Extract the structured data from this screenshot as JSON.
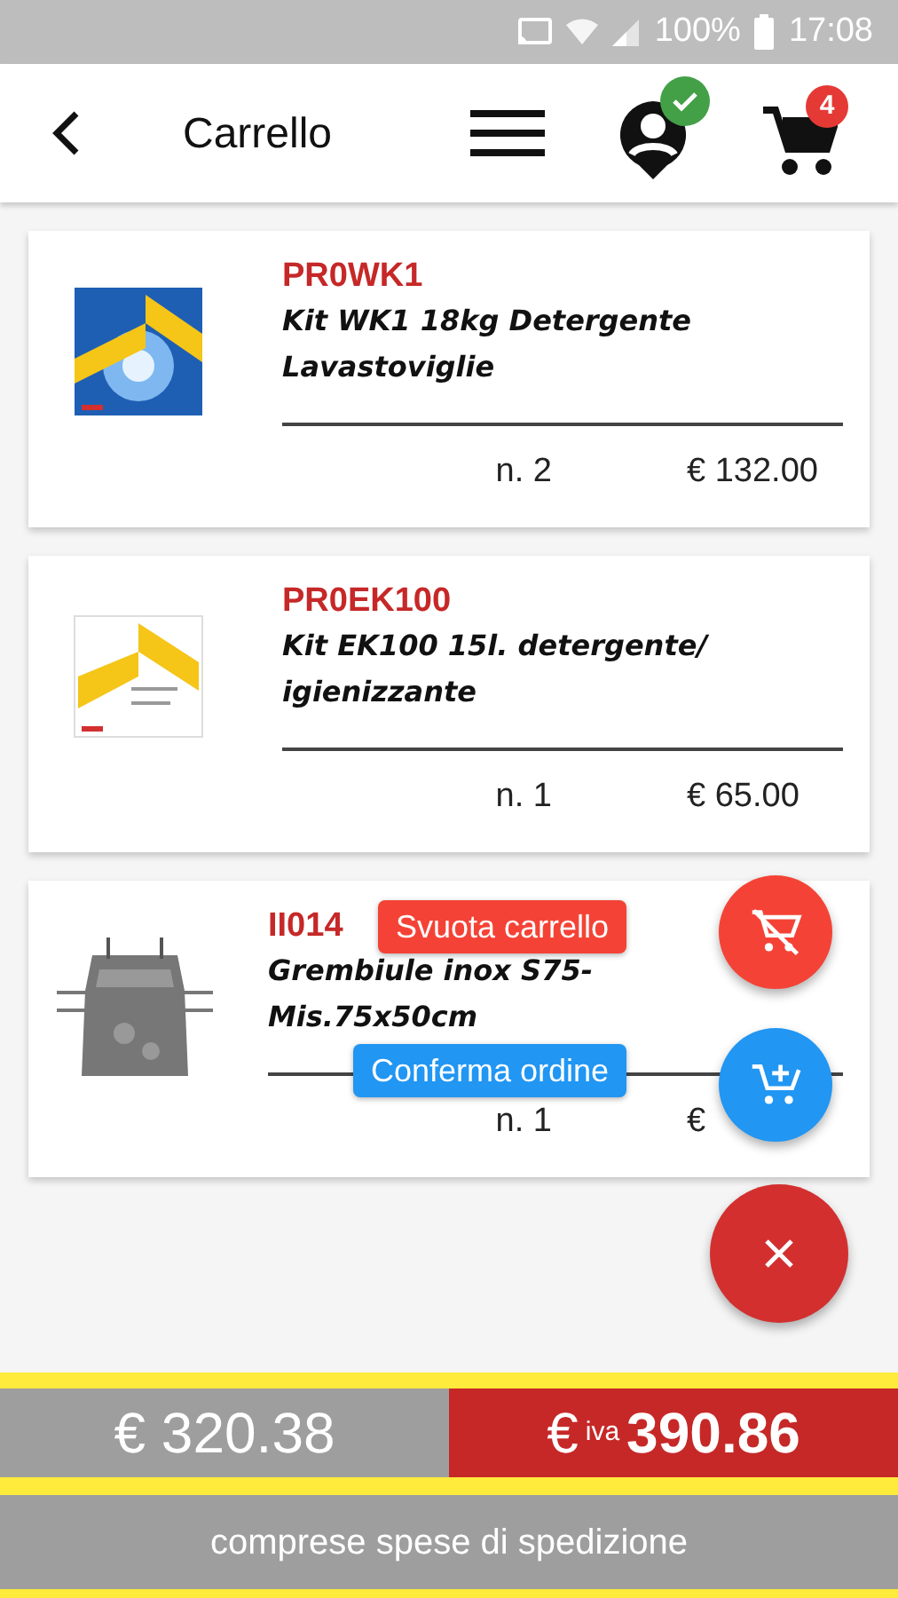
{
  "status_bar": {
    "battery": "100%",
    "time": "17:08"
  },
  "header": {
    "title": "Carrello",
    "cart_count": "4"
  },
  "items": [
    {
      "code": "PR0WK1",
      "name": "Kit WK1 18kg Detergente Lavastoviglie",
      "quantity": "n. 2",
      "price": "€ 132.00"
    },
    {
      "code": "PR0EK100",
      "name": "Kit EK100 15l. detergente/ igienizzante",
      "quantity": "n. 1",
      "price": "€ 65.00"
    },
    {
      "code": "II014",
      "name": "Grembiule inox S75-Mis.75x50cm",
      "quantity": "n. 1",
      "price": "€"
    }
  ],
  "fab_actions": [
    {
      "kind": "clear",
      "label": "Svuota carrello"
    },
    {
      "kind": "confirm",
      "label": "Conferma ordine"
    }
  ],
  "totals": {
    "net": "€ 320.38",
    "gross_currency": "€",
    "gross_tag": "iva",
    "gross": "390.86",
    "note": "comprese spese di spedizione"
  }
}
